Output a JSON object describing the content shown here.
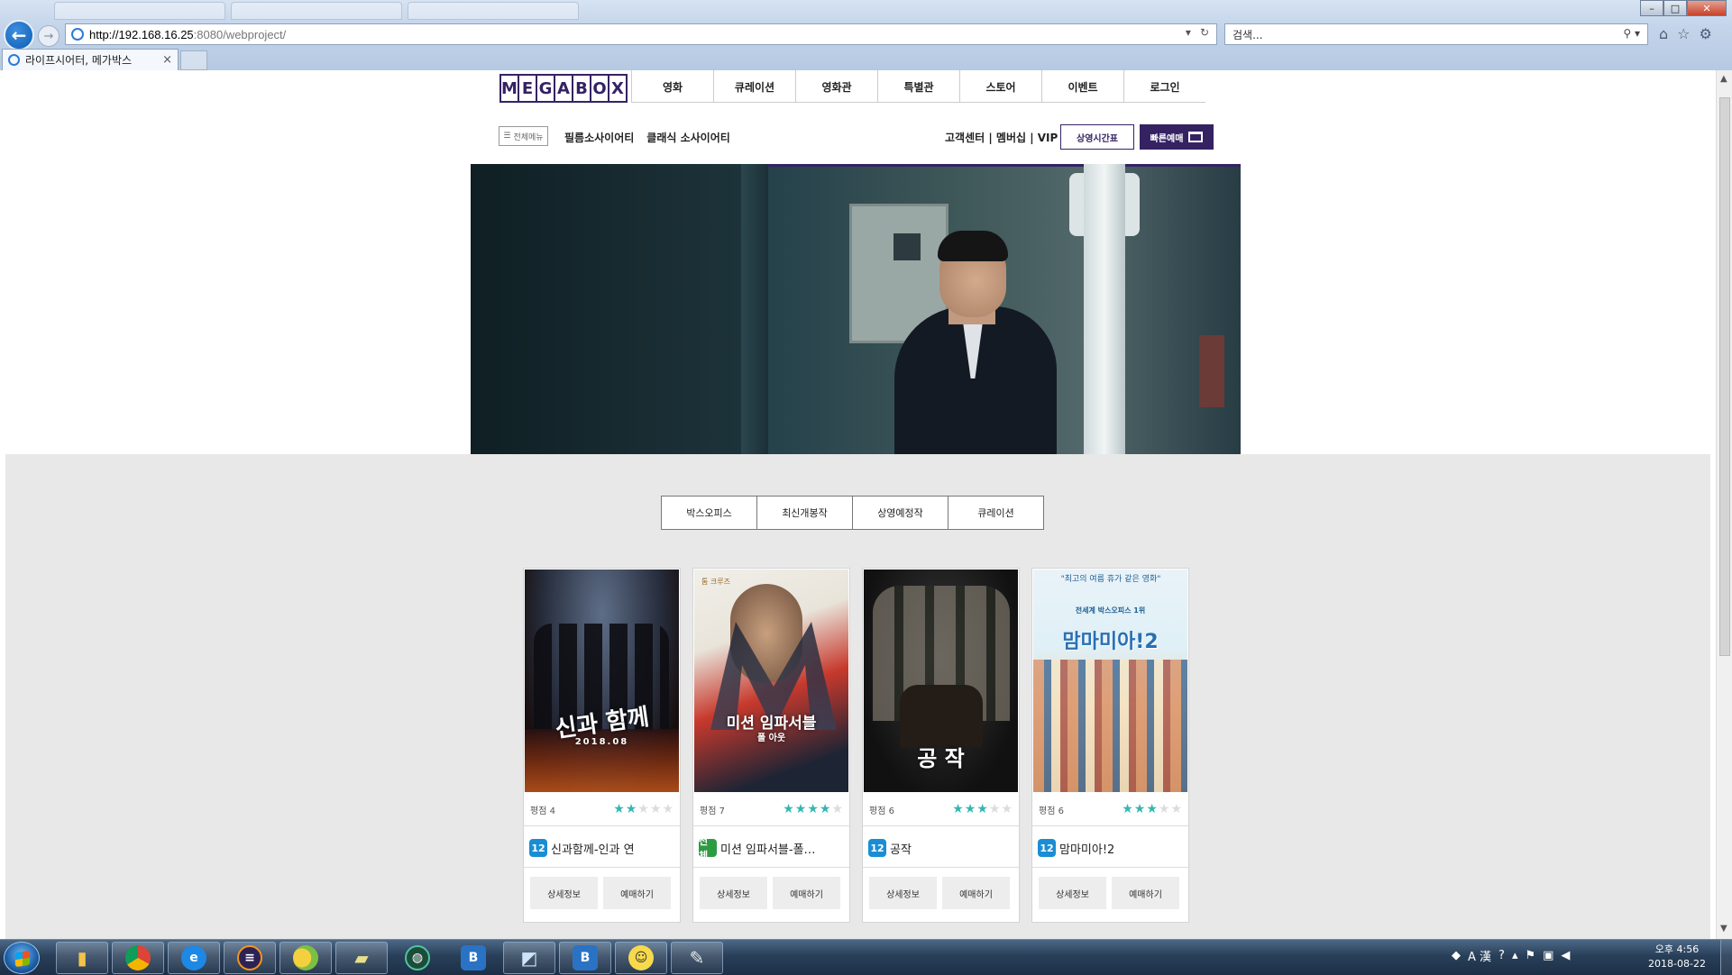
{
  "browser": {
    "url_host": "http://192.168.16.25",
    "url_rest": ":8080/webproject/",
    "search_placeholder": "검색...",
    "tab_title": "라이프시어터, 메가박스",
    "tab_close": "×",
    "back_icon": "←",
    "forward_icon": "→"
  },
  "header": {
    "logo_letters": [
      "M",
      "E",
      "G",
      "A",
      "B",
      "O",
      "X"
    ],
    "gnb": [
      "영화",
      "큐레이션",
      "영화관",
      "특별관",
      "스토어",
      "이벤트",
      "로그인"
    ],
    "menu_all": "전체메뉴",
    "sub_links": [
      "필름소사이어티",
      "클래식 소사이어티"
    ],
    "util_links": "고객센터 | 멤버십 | VIP",
    "btn_schedule": "상영시간표",
    "btn_quick": "빠른예매"
  },
  "content": {
    "tabs": [
      "박스오피스",
      "최신개봉작",
      "상영예정작",
      "큐레이션"
    ],
    "movies": [
      {
        "title": "신과함께-인과 연",
        "age": "12",
        "rating_label": "평점 4",
        "stars": 2,
        "poster_text": "신과 함께",
        "poster_sub": "2018.08",
        "btn_detail": "상세정보",
        "btn_book": "예매하기"
      },
      {
        "title": "미션 임파서블-폴…",
        "age": "전체",
        "rating_label": "평점 7",
        "stars": 4,
        "poster_text": "미션 임파서블",
        "poster_sub": "폴 아웃",
        "poster_tag": "톰 크루즈",
        "btn_detail": "상세정보",
        "btn_book": "예매하기"
      },
      {
        "title": "공작",
        "age": "12",
        "rating_label": "평점 6",
        "stars": 3,
        "poster_text": "공 작",
        "btn_detail": "상세정보",
        "btn_book": "예매하기"
      },
      {
        "title": "맘마미아!2",
        "age": "12",
        "rating_label": "평점 6",
        "stars": 3,
        "poster_text": "맘마미아!2",
        "poster_quote": "\"최고의 여름 휴가 같은 영화\"",
        "poster_sub": "전세계 박스오피스 1위",
        "btn_detail": "상세정보",
        "btn_book": "예매하기"
      }
    ]
  },
  "taskbar": {
    "clock_time": "오후 4:56",
    "clock_date": "2018-08-22",
    "tray_ime": "A 漢"
  },
  "colors": {
    "brand": "#352263",
    "star": "#36b6b0",
    "age12": "#1a8dd4",
    "ageAll": "#2d9b42"
  }
}
